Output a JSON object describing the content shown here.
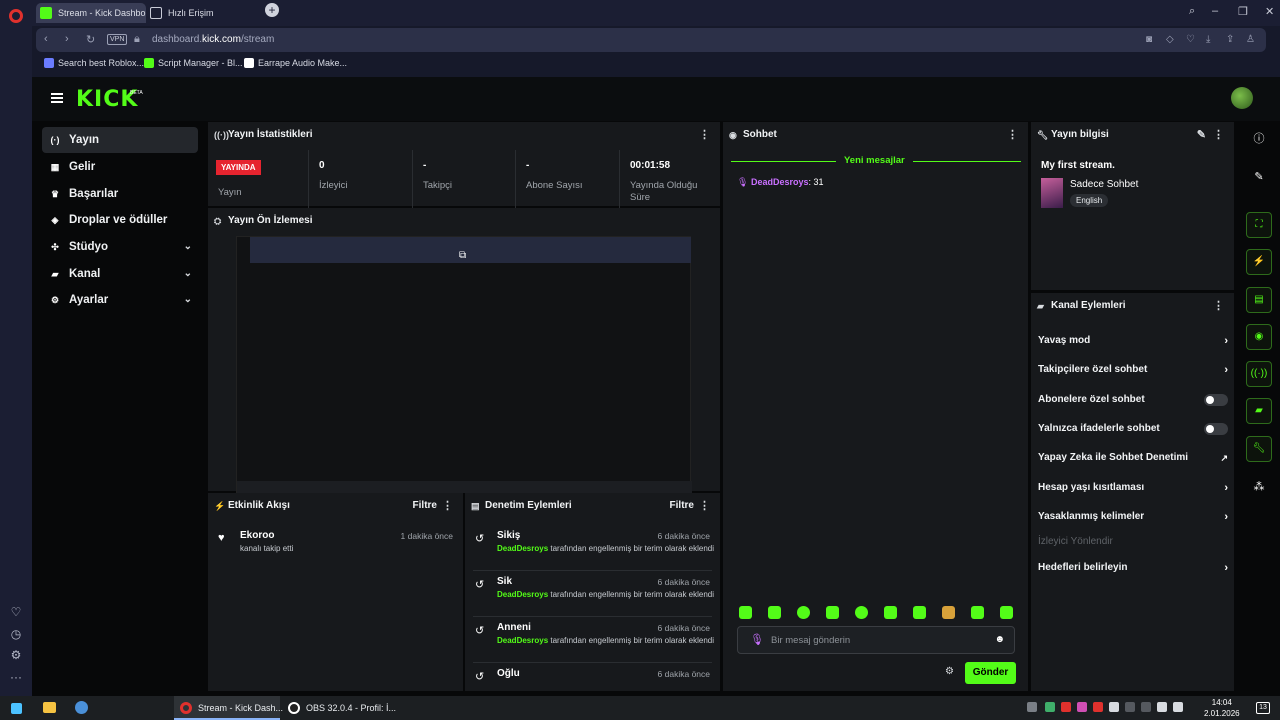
{
  "browser": {
    "tabs": [
      {
        "label": "Stream - Kick Dashbo",
        "active": true
      },
      {
        "label": "Hızlı Erişim",
        "active": false
      }
    ],
    "url_prefix": "dashboard.",
    "url_host": "kick.com",
    "url_path": "/stream",
    "vpn_label": "VPN",
    "bookmarks": [
      "Search best Roblox...",
      "Script Manager - Bl...",
      "Earrape Audio Make..."
    ]
  },
  "header": {
    "logo": "KICK",
    "logo_badge": "BETA"
  },
  "leftnav": {
    "items": [
      {
        "label": "Yayın",
        "icon": "(·)"
      },
      {
        "label": "Gelir",
        "icon": "▦"
      },
      {
        "label": "Başarılar",
        "icon": "♛"
      },
      {
        "label": "Droplar ve ödüller",
        "icon": "◈"
      },
      {
        "label": "Stüdyo",
        "icon": "✣"
      },
      {
        "label": "Kanal",
        "icon": "▰"
      },
      {
        "label": "Ayarlar",
        "icon": "⚙"
      }
    ]
  },
  "stats": {
    "title": "Yayın İstatistikleri",
    "live_badge": "YAYINDA",
    "live_label": "Yayın",
    "viewers_value": "0",
    "viewers_label": "İzleyici",
    "followers_value": "-",
    "followers_label": "Takipçi",
    "subs_value": "-",
    "subs_label": "Abone Sayısı",
    "uptime_value": "00:01:58",
    "uptime_label": "Yayında Olduğu Süre"
  },
  "preview": {
    "title": "Yayın Ön İzlemesi"
  },
  "activity": {
    "title": "Etkinlik Akışı",
    "filter": "Filtre",
    "items": [
      {
        "name": "Ekoroo",
        "desc": "kanalı takip etti",
        "time": "1 dakika önce"
      }
    ]
  },
  "moderation": {
    "title": "Denetim Eylemleri",
    "filter": "Filtre",
    "user": "DeadDesroys",
    "desc": "tarafından engellenmiş bir terim olarak eklendi",
    "items": [
      {
        "term": "Sikiş",
        "time": "6 dakika önce"
      },
      {
        "term": "Sik",
        "time": "6 dakika önce"
      },
      {
        "term": "Anneni",
        "time": "6 dakika önce"
      },
      {
        "term": "Oğlu",
        "time": "6 dakika önce"
      }
    ]
  },
  "chat": {
    "title": "Sohbet",
    "new_messages": "Yeni mesajlar",
    "message_user": "DeadDesroys",
    "message_text": "31",
    "placeholder": "Bir mesaj gönderin",
    "send": "Gönder"
  },
  "stream_info": {
    "title": "Yayın bilgisi",
    "stream_title": "My first stream.",
    "category": "Sadece Sohbet",
    "language": "English"
  },
  "channel_actions": {
    "title": "Kanal Eylemleri",
    "items": [
      {
        "label": "Yavaş mod",
        "control": "chevron"
      },
      {
        "label": "Takipçilere özel sohbet",
        "control": "chevron"
      },
      {
        "label": "Abonelere özel sohbet",
        "control": "toggle"
      },
      {
        "label": "Yalnızca ifadelerle sohbet",
        "control": "toggle"
      },
      {
        "label": "Yapay Zeka ile Sohbet Denetimi",
        "control": "external"
      },
      {
        "label": "Hesap yaşı kısıtlaması",
        "control": "chevron"
      },
      {
        "label": "Yasaklanmış kelimeler",
        "control": "chevron"
      },
      {
        "label": "İzleyici Yönlendir",
        "control": "none"
      },
      {
        "label": "Hedefleri belirleyin",
        "control": "chevron"
      }
    ]
  },
  "taskbar": {
    "apps": [
      "Stream - Kick Dash...",
      "OBS 32.0.4 - Profil: İ..."
    ],
    "time": "14:04",
    "date": "2.01.2026",
    "badge": "13"
  },
  "colors": {
    "accent": "#53fc18",
    "live": "#e6242f",
    "chat_user": "#c970ff"
  }
}
